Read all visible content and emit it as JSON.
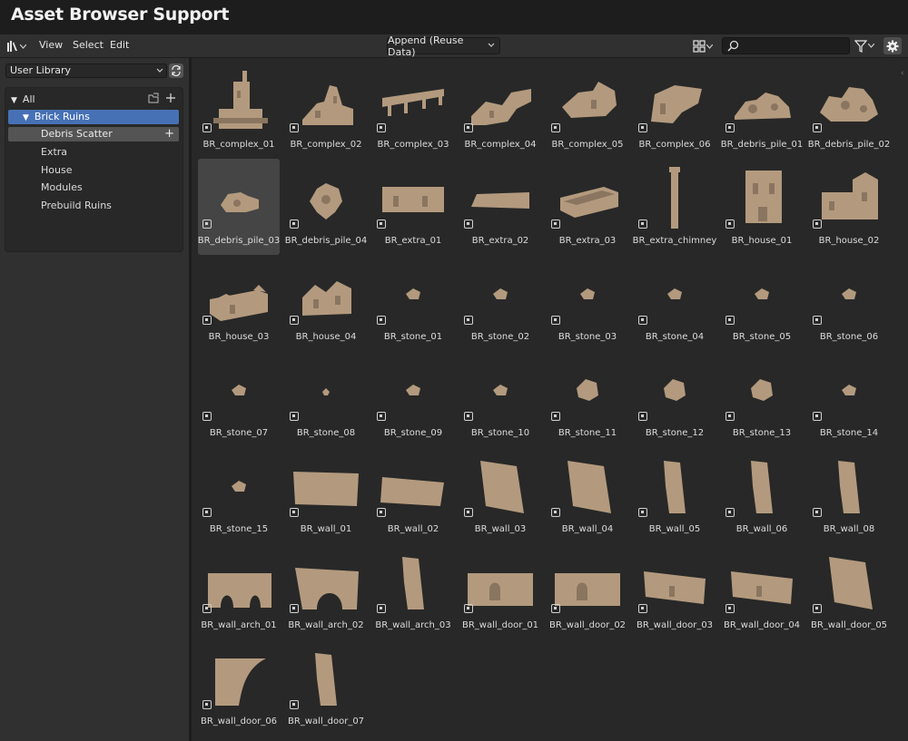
{
  "window": {
    "title": "Asset Browser Support"
  },
  "header": {
    "menus": [
      "View",
      "Select",
      "Edit"
    ],
    "import_method": "Append (Reuse Data)",
    "search_value": "",
    "search_placeholder": ""
  },
  "sidebar": {
    "library": "User Library",
    "categories": {
      "all": "All",
      "selected": "Brick Ruins",
      "active_sub": "Debris Scatter",
      "subs": [
        "Extra",
        "House",
        "Modules",
        "Prebuild Ruins"
      ]
    }
  },
  "colors": {
    "accent": "#4771b5",
    "panel": "#303030",
    "grid_bg": "#282828",
    "stone": "#b39a7e"
  },
  "assets": [
    {
      "name": "BR_complex_01",
      "shape": "complex1"
    },
    {
      "name": "BR_complex_02",
      "shape": "complex2"
    },
    {
      "name": "BR_complex_03",
      "shape": "complex3"
    },
    {
      "name": "BR_complex_04",
      "shape": "complex4"
    },
    {
      "name": "BR_complex_05",
      "shape": "complex5"
    },
    {
      "name": "BR_complex_06",
      "shape": "complex6"
    },
    {
      "name": "BR_debris_pile_01",
      "shape": "pile"
    },
    {
      "name": "BR_debris_pile_02",
      "shape": "pile2"
    },
    {
      "name": "BR_debris_pile_03",
      "shape": "pile3",
      "selected": true
    },
    {
      "name": "BR_debris_pile_04",
      "shape": "pile4"
    },
    {
      "name": "BR_extra_01",
      "shape": "longwall"
    },
    {
      "name": "BR_extra_02",
      "shape": "slab"
    },
    {
      "name": "BR_extra_03",
      "shape": "box"
    },
    {
      "name": "BR_extra_chimney",
      "shape": "chimney"
    },
    {
      "name": "BR_house_01",
      "shape": "tower"
    },
    {
      "name": "BR_house_02",
      "shape": "house2"
    },
    {
      "name": "BR_house_03",
      "shape": "house3"
    },
    {
      "name": "BR_house_04",
      "shape": "house4"
    },
    {
      "name": "BR_stone_01",
      "shape": "stone"
    },
    {
      "name": "BR_stone_02",
      "shape": "stone"
    },
    {
      "name": "BR_stone_03",
      "shape": "stone"
    },
    {
      "name": "BR_stone_04",
      "shape": "stone"
    },
    {
      "name": "BR_stone_05",
      "shape": "stone"
    },
    {
      "name": "BR_stone_06",
      "shape": "stone"
    },
    {
      "name": "BR_stone_07",
      "shape": "stone"
    },
    {
      "name": "BR_stone_08",
      "shape": "stone_small"
    },
    {
      "name": "BR_stone_09",
      "shape": "stone"
    },
    {
      "name": "BR_stone_10",
      "shape": "stone"
    },
    {
      "name": "BR_stone_11",
      "shape": "stone_big"
    },
    {
      "name": "BR_stone_12",
      "shape": "stone_big"
    },
    {
      "name": "BR_stone_13",
      "shape": "stone_big"
    },
    {
      "name": "BR_stone_14",
      "shape": "stone"
    },
    {
      "name": "BR_stone_15",
      "shape": "stone"
    },
    {
      "name": "BR_wall_01",
      "shape": "wall"
    },
    {
      "name": "BR_wall_02",
      "shape": "wall_tilt"
    },
    {
      "name": "BR_wall_03",
      "shape": "wall_tall"
    },
    {
      "name": "BR_wall_04",
      "shape": "wall_tall"
    },
    {
      "name": "BR_wall_05",
      "shape": "wall_narrow"
    },
    {
      "name": "BR_wall_06",
      "shape": "wall_narrow"
    },
    {
      "name": "BR_wall_08",
      "shape": "wall_narrow"
    },
    {
      "name": "BR_wall_arch_01",
      "shape": "arch2"
    },
    {
      "name": "BR_wall_arch_02",
      "shape": "arch1"
    },
    {
      "name": "BR_wall_arch_03",
      "shape": "wall_narrow"
    },
    {
      "name": "BR_wall_door_01",
      "shape": "door"
    },
    {
      "name": "BR_wall_door_02",
      "shape": "door"
    },
    {
      "name": "BR_wall_door_03",
      "shape": "door_long"
    },
    {
      "name": "BR_wall_door_04",
      "shape": "door_long"
    },
    {
      "name": "BR_wall_door_05",
      "shape": "wall_tall"
    },
    {
      "name": "BR_wall_door_06",
      "shape": "wall_curve"
    },
    {
      "name": "BR_wall_door_07",
      "shape": "wall_narrow"
    }
  ]
}
